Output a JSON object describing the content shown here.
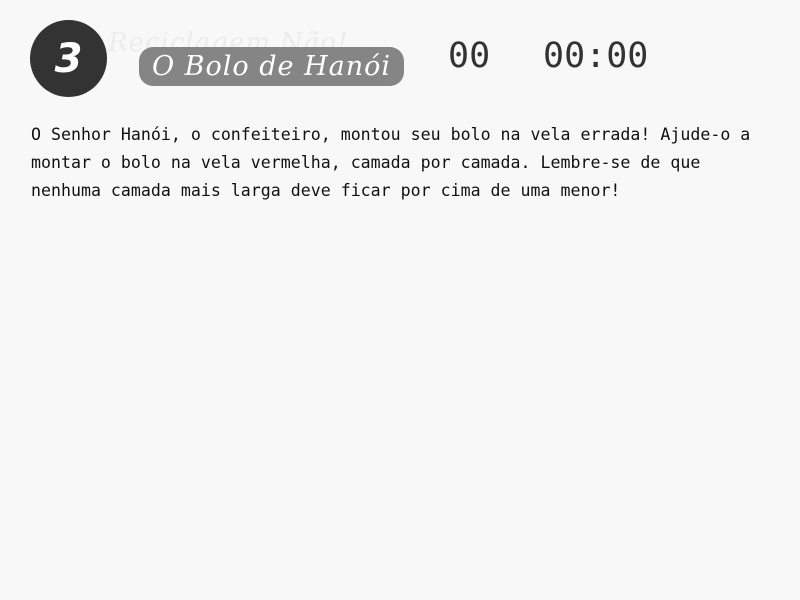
{
  "header": {
    "level": "3",
    "ghost_title": "Reciclagem Não!",
    "title": "O Bolo de Hanói",
    "moves": "00",
    "timer": "00:00"
  },
  "instructions": "O Senhor Hanói, o confeiteiro, montou seu bolo na vela errada! Ajude-o a montar o bolo na vela vermelha, camada por camada. Lembre-se de que nenhuma camada mais larga deve ficar por cima de uma menor!",
  "colors": {
    "background": "#f8f8f8",
    "badge": "#333333",
    "title_pill": "#858585",
    "text": "#111111"
  }
}
